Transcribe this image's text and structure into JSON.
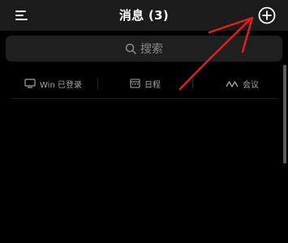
{
  "header": {
    "title": "消息 (3)",
    "menu_icon": "menu-icon",
    "add_icon": "add-circle-icon"
  },
  "search": {
    "placeholder": "搜索",
    "icon": "search-icon"
  },
  "shortcuts": [
    {
      "label": "Win 已登录",
      "icon": "monitor-icon"
    },
    {
      "label": "日程",
      "icon": "calendar-icon"
    },
    {
      "label": "会议",
      "icon": "meeting-icon"
    }
  ],
  "annotation": {
    "arrow_color": "#e02020"
  },
  "colors": {
    "background": "#000000",
    "header": "#1b1b1b",
    "search_bg": "#1f1f1f",
    "muted_text": "#8c8c8c"
  }
}
